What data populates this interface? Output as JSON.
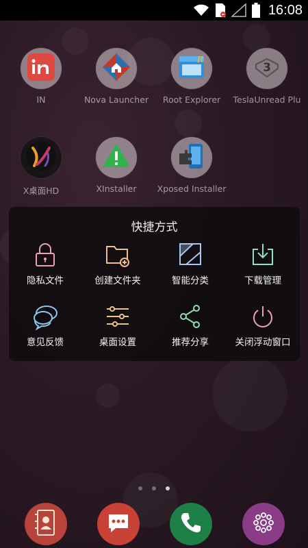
{
  "status_bar": {
    "time": "16:08"
  },
  "home": {
    "apps": [
      {
        "label": "IN",
        "icon": "in-app-icon"
      },
      {
        "label": "Nova Launcher",
        "icon": "nova-launcher-icon"
      },
      {
        "label": "Root Explorer",
        "icon": "root-explorer-icon"
      },
      {
        "label": "TeslaUnread Plu",
        "icon": "tesla-unread-icon",
        "badge": "3"
      },
      {
        "label": "X桌面HD",
        "icon": "x-desktop-icon"
      },
      {
        "label": "XInstaller",
        "icon": "xinstaller-icon"
      },
      {
        "label": "Xposed Installer",
        "icon": "xposed-installer-icon"
      }
    ]
  },
  "shortcut_panel": {
    "title": "快捷方式",
    "items": [
      {
        "label": "隐私文件",
        "icon": "lock-icon",
        "color": "#f2a0b0"
      },
      {
        "label": "创建文件夹",
        "icon": "new-folder-icon",
        "color": "#f2c08a"
      },
      {
        "label": "智能分类",
        "icon": "smart-category-icon",
        "color": "#a8c8f0"
      },
      {
        "label": "下载管理",
        "icon": "download-icon",
        "color": "#8fe0c8"
      },
      {
        "label": "意见反馈",
        "icon": "feedback-icon",
        "color": "#8ec8f0"
      },
      {
        "label": "桌面设置",
        "icon": "settings-sliders-icon",
        "color": "#f2c08a"
      },
      {
        "label": "推荐分享",
        "icon": "share-icon",
        "color": "#8fe0b0"
      },
      {
        "label": "关闭浮动窗口",
        "icon": "power-icon",
        "color": "#f2a0b0"
      }
    ]
  },
  "page_indicator": {
    "pages": 3,
    "current": 3
  },
  "dock": [
    {
      "icon": "contacts-icon",
      "color": "#c0392b"
    },
    {
      "icon": "messages-icon",
      "color": "#c0392b"
    },
    {
      "icon": "phone-icon",
      "color": "#1e8a4a"
    },
    {
      "icon": "app-drawer-icon",
      "color": "#8e3d8a"
    }
  ]
}
